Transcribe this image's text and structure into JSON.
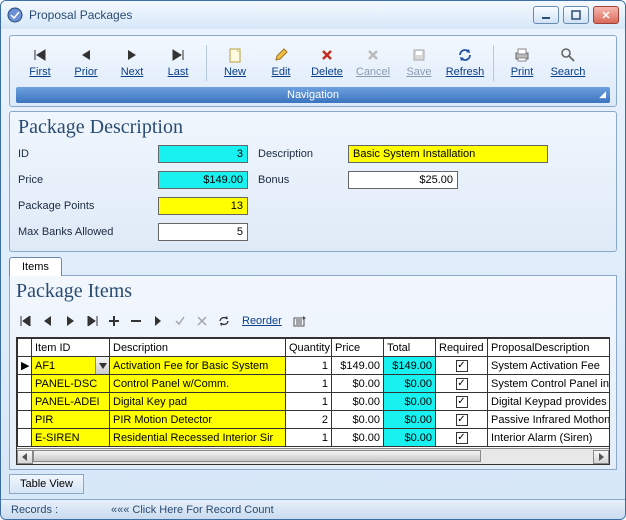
{
  "window": {
    "title": "Proposal Packages"
  },
  "toolbar": {
    "first": "First",
    "prior": "Prior",
    "next": "Next",
    "last": "Last",
    "new": "New",
    "edit": "Edit",
    "delete": "Delete",
    "cancel": "Cancel",
    "save": "Save",
    "refresh": "Refresh",
    "print": "Print",
    "search": "Search",
    "nav_label": "Navigation"
  },
  "pkg": {
    "section_title": "Package Description",
    "id_label": "ID",
    "id": "3",
    "desc_label": "Description",
    "desc": "Basic System Installation",
    "price_label": "Price",
    "price": "$149.00",
    "bonus_label": "Bonus",
    "bonus": "$25.00",
    "points_label": "Package Points",
    "points": "13",
    "maxbanks_label": "Max Banks Allowed",
    "maxbanks": "5"
  },
  "tabs": {
    "items": "Items"
  },
  "items": {
    "section_title": "Package Items",
    "reorder": "Reorder",
    "columns": {
      "item_id": "Item ID",
      "description": "Description",
      "quantity": "Quantity",
      "price": "Price",
      "total": "Total",
      "required": "Required",
      "proposal_desc": "ProposalDescription"
    },
    "rows": [
      {
        "id": "AF1",
        "desc": "Activation Fee for Basic System",
        "qty": "1",
        "price": "$149.00",
        "total": "$149.00",
        "req": true,
        "pdesc": "System Activation Fee"
      },
      {
        "id": "PANEL-DSC",
        "desc": "Control Panel w/Comm.",
        "qty": "1",
        "price": "$0.00",
        "total": "$0.00",
        "req": true,
        "pdesc": "System Control Panel included"
      },
      {
        "id": "PANEL-ADEI",
        "desc": "Digital Key pad",
        "qty": "1",
        "price": "$0.00",
        "total": "$0.00",
        "req": true,
        "pdesc": "Digital Keypad provides comple"
      },
      {
        "id": "PIR",
        "desc": "PIR Motion Detector",
        "qty": "2",
        "price": "$0.00",
        "total": "$0.00",
        "req": true,
        "pdesc": "Passive Infrared Mothon Detec"
      },
      {
        "id": "E-SIREN",
        "desc": "Residential Recessed Interior Sir",
        "qty": "1",
        "price": "$0.00",
        "total": "$0.00",
        "req": true,
        "pdesc": "Interior Alarm (Siren)"
      }
    ]
  },
  "footer": {
    "table_view": "Table View",
    "records_label": "Records :",
    "records_hint": "««« Click Here For Record Count"
  }
}
